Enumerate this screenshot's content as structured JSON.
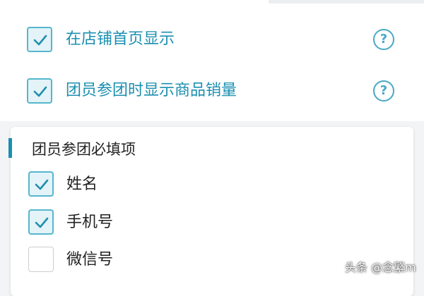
{
  "settings": [
    {
      "label": "在店铺首页显示",
      "checked": true,
      "help_icon": "question-circle-icon",
      "help_glyph": "?"
    },
    {
      "label": "团员参团时显示商品销量",
      "checked": true,
      "help_icon": "question-circle-icon",
      "help_glyph": "?"
    }
  ],
  "required_fields": {
    "title": "团员参团必填项",
    "items": [
      {
        "label": "姓名",
        "checked": true
      },
      {
        "label": "手机号",
        "checked": true
      },
      {
        "label": "微信号",
        "checked": false
      }
    ]
  },
  "watermark": "头条 @念繁m",
  "colors": {
    "accent": "#1b8fb0",
    "checkbox_border": "#55b6cd",
    "checkbox_fill": "#e3f3f8",
    "check_mark": "#1f8fae"
  }
}
